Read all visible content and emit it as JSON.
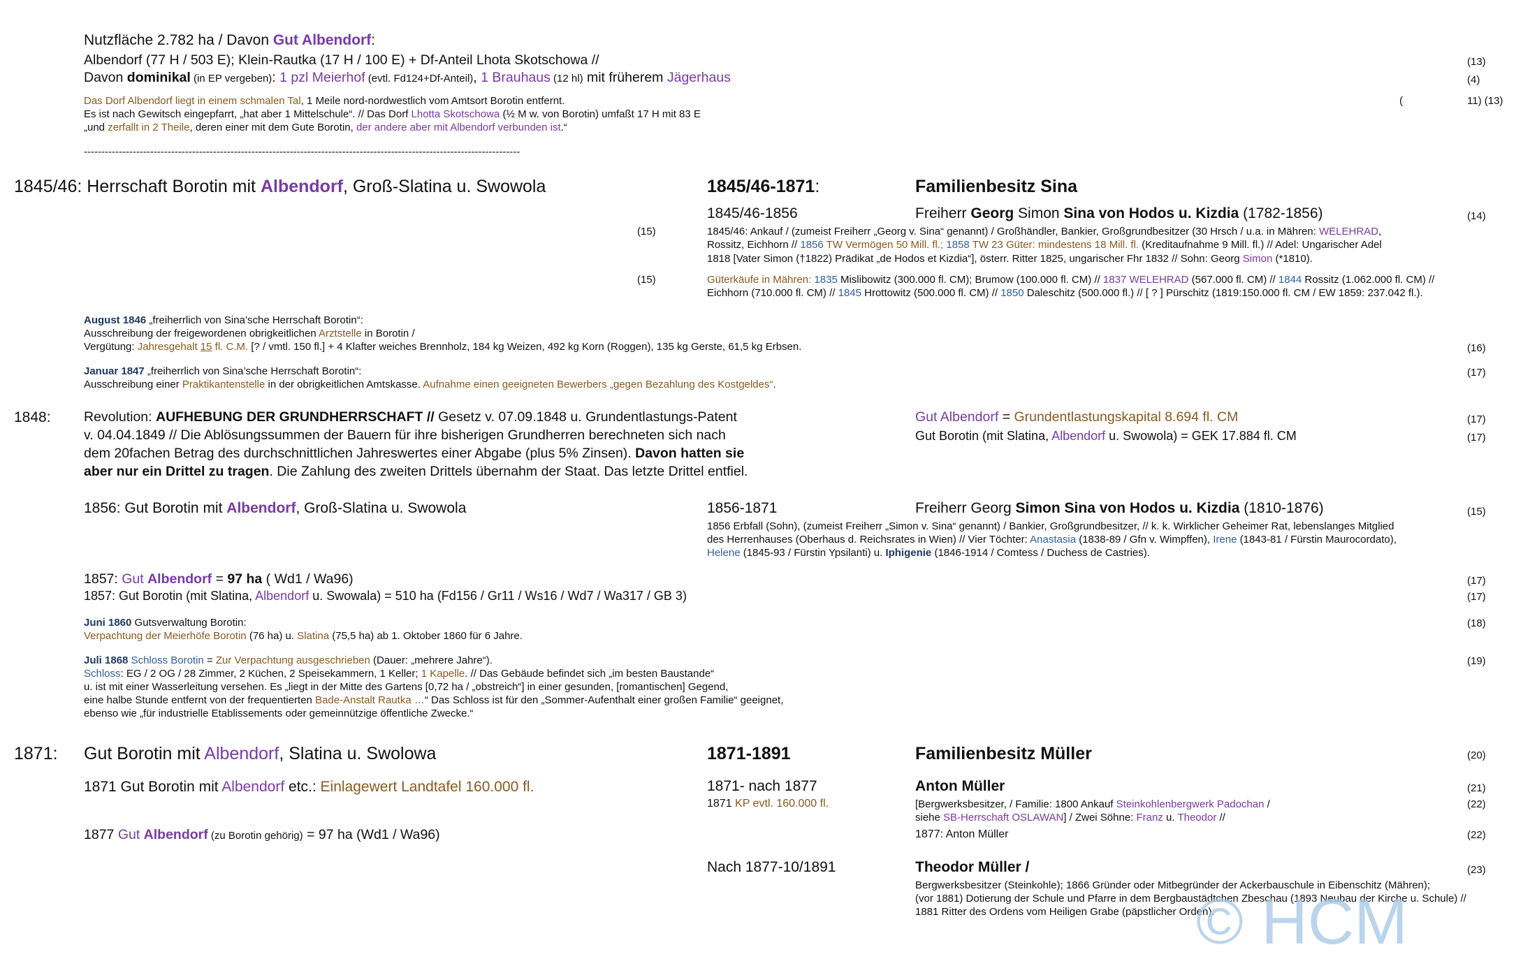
{
  "header": {
    "l1": {
      "a": "Nutzfläche 2.782 ha / Davon ",
      "b": "Gut Albendorf",
      "c": ":"
    },
    "l2": "Albendorf (77 H / 503 E); Klein-Rautka (17 H / 100 E) + Df-Anteil Lhota Skotschowa //",
    "l3": {
      "a": "Davon ",
      "b": "dominikal",
      "c": " (in EP vergeben)",
      "d": ": ",
      "e": "1 pzl Meierhof",
      "f": " (evtl. Fd124+Df-Anteil)",
      "g": ", ",
      "h": "1 Brauhaus",
      "i": " (12 hl)",
      "j": " mit früherem ",
      "k": "Jägerhaus"
    },
    "p1": {
      "a": "Das Dorf Albendorf liegt in einem schmalen Tal",
      "b": ", 1 Meile nord-nordwestlich vom Amtsort Borotin entfernt."
    },
    "p2": {
      "a": "Es ist nach Gewitsch eingepfarrt, „hat aber 1 Mittelschule“. // Das Dorf ",
      "b": "Lhotta Skotschowa",
      "c": " (½ M w. von Borotin) umfaßt 17 H mit 83 E"
    },
    "p3": {
      "a": "„und ",
      "b": "zerfallt in 2 Theile",
      "c": ", deren einer mit dem Gute Borotin, ",
      "d": "der andere aber mit Albendorf verbunden ist",
      "e": ".“"
    },
    "divider": "-----------------------------------------------------------------------------------------------------------------------------",
    "refs": {
      "r1": "(13)",
      "r2": "(4)",
      "r3a": "(",
      "r3b": "11) (13)"
    }
  },
  "sec1845": {
    "left": {
      "a": "1845/46: Herrschaft Borotin mit ",
      "b": "Albendorf",
      "c": ", Groß-Slatina u. Swowola"
    },
    "period": {
      "a": "1845/46-1871",
      "b": ":"
    },
    "owner": "Familienbesitz Sina",
    "sub_period": "1845/46-1856",
    "sub_owner": {
      "a": "Freiherr ",
      "b": "Georg",
      "c": " Simon ",
      "d": "Sina von Hodos u. Kizdia",
      "e": " (1782-1856)"
    },
    "ref14": "(14)",
    "ref15a": "(15)",
    "ref15b": "(15)",
    "d1": {
      "a": "1845/46: Ankauf / (zumeist Freiherr „Georg v. Sina“ genannt) / Großhändler, Bankier, Großgrundbesitzer (30 Hrsch / u.a. in Mähren: ",
      "b": "WELEHRAD",
      "c": ","
    },
    "d2": {
      "a": "Rossitz, Eichhorn // ",
      "b": "1856",
      "c": " TW Vermögen 50 Mill. fl.; ",
      "d": "1858",
      "e": " TW 23 Güter: mindestens 18 Mill. fl.",
      "f": " (Kreditaufnahme 9 Mill. fl.) // Adel: Ungarischer Adel"
    },
    "d3": {
      "a": "1818 [Vater Simon (†1822) Prädikat „de Hodos et Kizdia“], österr. Ritter 1825, ungarischer Fhr 1832 // Sohn: Georg ",
      "b": "Simon",
      "c": " (*1810)."
    },
    "g1": {
      "a": "Güterkäufe in Mähren: ",
      "b": "1835",
      "c": " Mislibowitz (300.000 fl. CM); Brumow (100.000 fl. CM) // ",
      "d": "1837 WELEHRAD",
      "e": " (567.000 fl. CM) // ",
      "f": "1844",
      "g": " Rossitz (1.062.000 fl. CM) //"
    },
    "g2": {
      "a": "Eichhorn (710.000 fl. CM) // ",
      "b": "1845",
      "c": " Hrottowitz (500.000 fl. CM) // ",
      "d": "1850",
      "e": " Daleschitz (500.000 fl.) // [ ? ] Pürschitz (1819:150.000 fl. CM / EW 1859: 237.042 fl.)."
    }
  },
  "aug1846": {
    "l1": {
      "a": "August 1846",
      "b": " „freiherrlich von Sina’sche Herrschaft Borotin“:"
    },
    "l2": {
      "a": "Ausschreibung der freigewordenen obrigkeitlichen ",
      "b": "Arztstelle",
      "c": " in Borotin /"
    },
    "l3": {
      "a": "Vergütung: ",
      "b": "Jahresgehalt ",
      "c": "15",
      "d": " fl. C.M.",
      "e": " [? / vmtl. 150 fl.] + 4 Klafter weiches Brennholz, 184 kg Weizen, 492 kg Korn (Roggen), 135 kg Gerste, 61,5 kg Erbsen."
    },
    "ref": "(16)"
  },
  "jan1847": {
    "l1": {
      "a": "Januar 1847",
      "b": " „freiherrlich von Sina’sche Herrschaft Borotin“:"
    },
    "l2": {
      "a": "Ausschreibung einer ",
      "b": "Praktikantenstelle",
      "c": " in der obrigkeitlichen Amtskasse. ",
      "d": "Aufnahme einen geeigneten Bewerbers „gegen Bezahlung des Kostgeldes“",
      "e": "."
    },
    "ref": "(17)"
  },
  "sec1848": {
    "year": "1848:",
    "l1": {
      "a": "Revolution: ",
      "b": "AUFHEBUNG DER GRUNDHERRSCHAFT //",
      "c": " Gesetz v. 07.09.1848 u. Grundentlastungs-Patent"
    },
    "l2": "v. 04.04.1849 // Die Ablösungssummen der Bauern für ihre bisherigen Grundherren berechneten sich nach",
    "l3": {
      "a": "dem 20fachen Betrag des durchschnittlichen Jahreswertes einer Abgabe (plus 5% Zinsen). ",
      "b": "Davon hatten sie"
    },
    "l4": {
      "a": "aber nur ein Drittel zu tragen",
      "b": ". Die Zahlung des zweiten Drittels übernahm der Staat. Das letzte Drittel entfiel."
    },
    "r1": {
      "a": "Gut Albendorf",
      "b": " = ",
      "c": "Grundentlastungskapital 8.694 fl. CM"
    },
    "r2": {
      "a": "Gut Borotin (mit Slatina, ",
      "b": "Albendorf",
      "c": " u. Swowola) = GEK 17.884 fl. CM"
    },
    "ref1": "(17)",
    "ref2": "(17)"
  },
  "sec1856": {
    "left": {
      "a": "1856: Gut Borotin mit ",
      "b": "Albendorf",
      "c": ", Groß-Slatina u. Swowola"
    },
    "period": "1856-1871",
    "owner": {
      "a": "Freiherr Georg ",
      "b": "Simon Sina von Hodos u. Kizdia",
      "c": " (1810-1876)"
    },
    "ref": "(15)",
    "d1": "1856 Erbfall (Sohn), (zumeist Freiherr „Simon v. Sina“ genannt) / Bankier, Großgrundbesitzer, // k. k. Wirklicher Geheimer Rat, lebenslanges Mitglied",
    "d2": {
      "a": "des Herrenhauses (Oberhaus d. Reichsrates in Wien) // Vier Töchter: ",
      "b": "Anastasia",
      "c": " (1838-89 / Gfn v. Wimpffen), ",
      "d": "Irene",
      "e": " (1843-81 / Fürstin Maurocordato),"
    },
    "d3": {
      "a": "Helene",
      "b": " (1845-93 / Fürstin Ypsilanti) u. ",
      "c": "Iphigenie",
      "d": " (1846-1914 / Comtess / Duchess de Castries)."
    }
  },
  "sec1857": {
    "l1": {
      "a": "1857: ",
      "b": "Gut ",
      "c": "Albendorf",
      "d": " = ",
      "e": "97 ha",
      "f": " ( Wd1 / Wa96)"
    },
    "l2": {
      "a": "1857: Gut Borotin (mit Slatina, ",
      "b": "Albendorf",
      "c": " u. Swowala) = 510 ha (Fd156 / Gr11 / Ws16 / Wd7 / Wa317 / GB 3)"
    },
    "ref1": "(17)",
    "ref2": "(17)"
  },
  "jun1860": {
    "l1": {
      "a": "Juni 1860",
      "b": " Gutsverwaltung Borotin:"
    },
    "l2": {
      "a": "Verpachtung der Meierhöfe Borotin",
      "b": " (76 ha) u. ",
      "c": "Slatina",
      "d": " (75,5 ha) ab 1. Oktober 1860 für 6 Jahre."
    },
    "ref": "(18)"
  },
  "jul1868": {
    "l1": {
      "a": "Juli 1868",
      "b": " Schloss Borotin",
      "c": " = ",
      "d": "Zur Verpachtung ausgeschrieben",
      "e": " (Dauer: „mehrere Jahre“)."
    },
    "l2": {
      "a": "Schloss",
      "b": ": EG / 2 OG / 28 Zimmer, 2 Küchen, 2 Speisekammern, 1 Keller; ",
      "c": "1 Kapelle",
      "d": ". // Das Gebäude befindet sich „im besten Baustande“"
    },
    "l3": "u. ist mit einer Wasserleitung versehen. Es „liegt in der Mitte des Gartens [0,72 ha / „obstreich“] in einer gesunden, [romantischen] Gegend,",
    "l4": {
      "a": "eine halbe Stunde entfernt von der frequentierten ",
      "b": "Bade-Anstalt Rautka …",
      "c": "“ Das Schloss ist für den „Sommer-Aufenthalt einer großen Familie“ geeignet,"
    },
    "l5": "ebenso wie „für industrielle Etablissements oder gemeinnützige öffentliche Zwecke.“",
    "ref": "(19)"
  },
  "sec1871": {
    "year": "1871:",
    "l1": {
      "a": "Gut Borotin mit ",
      "b": "Albendorf",
      "c": ", Slatina u. Swolowa"
    },
    "l2": {
      "a": "1871 Gut Borotin mit ",
      "b": "Albendorf",
      "c": " etc.: ",
      "d": "Einlagewert Landtafel 160.000 fl."
    },
    "l3": {
      "a": "1877 ",
      "b": "Gut ",
      "c": "Albendorf",
      "d": " (zu Borotin gehörig)",
      "e": " = 97 ha (Wd1 / Wa96)"
    },
    "period": "1871-1891",
    "owner": "Familienbesitz Müller",
    "ref20": "(20)",
    "p2": "1871- nach 1877",
    "p2b": {
      "a": "1871 ",
      "b": "KP evtl. 160.000 fl."
    },
    "o2": "Anton Müller",
    "ref21": "(21)",
    "o2d1": {
      "a": "[Bergwerksbesitzer, / Familie: 1800 Ankauf ",
      "b": "Steinkohlenbergwerk Padochan",
      "c": " /"
    },
    "ref22a": "(22)",
    "o2d2": {
      "a": "siehe ",
      "b": "SB-Herrschaft OSLAWAN",
      "c": "] / Zwei Söhne: ",
      "d": "Franz",
      "e": " u. ",
      "f": "Theodor",
      "g": " //"
    },
    "o2d3": "1877: Anton Müller",
    "ref22b": "(22)",
    "p3": "Nach 1877-10/1891",
    "o3": "Theodor Müller /",
    "ref23": "(23)",
    "o3d1": "Bergwerksbesitzer (Steinkohle); 1866 Gründer oder Mitbegründer der Ackerbauschule in Eibenschitz (Mähren);",
    "o3d2": "(vor 1881) Dotierung der Schule und Pfarre in dem Bergbaustädtchen Zbeschau (1893 Neubau der Kirche u. Schule) //",
    "o3d3": "1881 Ritter des Ordens vom Heiligen Grabe (päpstlicher Orden)."
  },
  "watermark": "© HCM",
  "colors": {
    "purple": "#7a3aa6",
    "gold": "#8b5a1e",
    "blue": "#2f5fa0",
    "navy": "#1f3864",
    "watermark": "#a9c8e6"
  }
}
